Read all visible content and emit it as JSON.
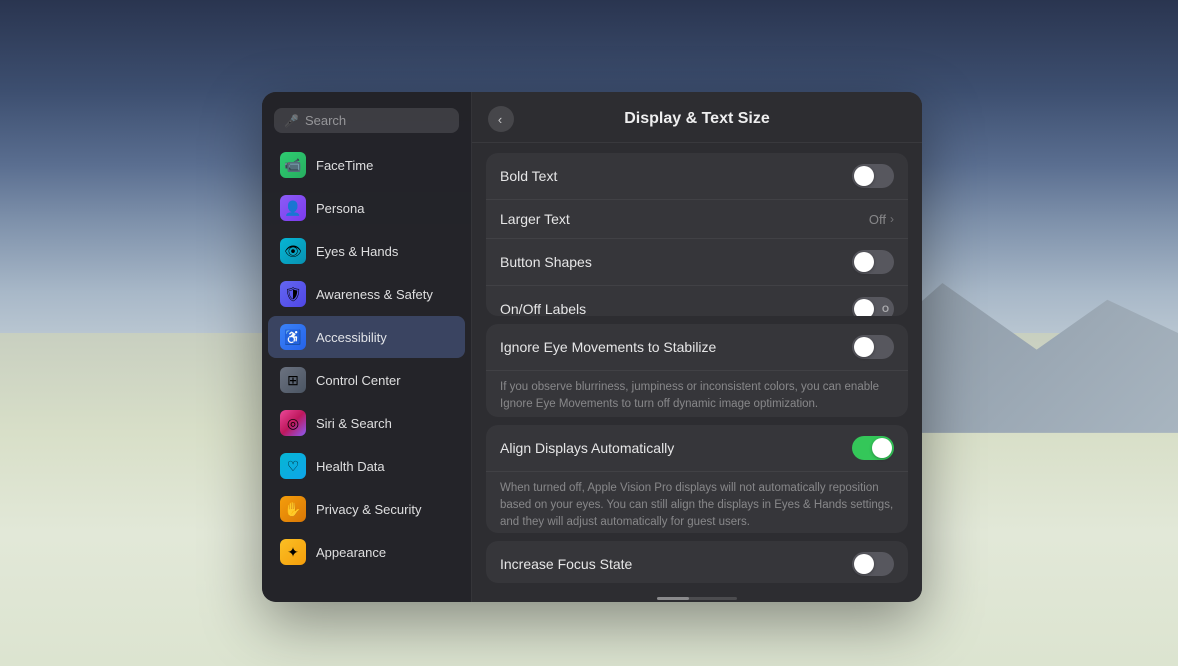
{
  "background": {
    "description": "Desert landscape with cloudy sky"
  },
  "sidebar": {
    "search": {
      "placeholder": "Search",
      "icon": "microphone"
    },
    "items": [
      {
        "id": "facetime",
        "label": "FaceTime",
        "icon": "📹",
        "iconClass": "icon-facetime",
        "active": false
      },
      {
        "id": "persona",
        "label": "Persona",
        "icon": "👤",
        "iconClass": "icon-persona",
        "active": false
      },
      {
        "id": "eyes-hands",
        "label": "Eyes & Hands",
        "icon": "👁",
        "iconClass": "icon-eyes",
        "active": false
      },
      {
        "id": "awareness-safety",
        "label": "Awareness & Safety",
        "icon": "🛡",
        "iconClass": "icon-awareness",
        "active": false
      },
      {
        "id": "accessibility",
        "label": "Accessibility",
        "icon": "♿",
        "iconClass": "icon-accessibility",
        "active": true
      },
      {
        "id": "control-center",
        "label": "Control Center",
        "icon": "⊞",
        "iconClass": "icon-control",
        "active": false
      },
      {
        "id": "siri-search",
        "label": "Siri & Search",
        "icon": "◎",
        "iconClass": "icon-siri",
        "active": false
      },
      {
        "id": "health-data",
        "label": "Health Data",
        "icon": "♡",
        "iconClass": "icon-health",
        "active": false
      },
      {
        "id": "privacy-security",
        "label": "Privacy & Security",
        "icon": "✋",
        "iconClass": "icon-privacy",
        "active": false
      },
      {
        "id": "appearance",
        "label": "Appearance",
        "icon": "✦",
        "iconClass": "icon-appearance",
        "active": false
      }
    ]
  },
  "main": {
    "title": "Display & Text Size",
    "back_button_label": "‹",
    "groups": [
      {
        "id": "text-group",
        "rows": [
          {
            "id": "bold-text",
            "label": "Bold Text",
            "control": "toggle",
            "value": false
          },
          {
            "id": "larger-text",
            "label": "Larger Text",
            "control": "disclosure",
            "value": "Off"
          },
          {
            "id": "button-shapes",
            "label": "Button Shapes",
            "control": "toggle",
            "value": false
          },
          {
            "id": "on-off-labels",
            "label": "On/Off Labels",
            "control": "toggle-o",
            "value": false
          }
        ]
      },
      {
        "id": "eye-movement-group",
        "rows": [
          {
            "id": "ignore-eye-movements",
            "label": "Ignore Eye Movements to Stabilize",
            "control": "toggle",
            "value": false
          }
        ],
        "description": "If you observe blurriness, jumpiness or inconsistent colors, you can enable Ignore Eye Movements to turn off dynamic image optimization."
      },
      {
        "id": "align-group",
        "rows": [
          {
            "id": "align-displays",
            "label": "Align Displays Automatically",
            "control": "toggle",
            "value": true
          }
        ],
        "description": "When turned off, Apple Vision Pro displays will not automatically reposition based on your eyes. You can still align the displays in Eyes & Hands settings, and they will adjust automatically for guest users."
      },
      {
        "id": "focus-group",
        "rows": [
          {
            "id": "increase-focus-state",
            "label": "Increase Focus State",
            "control": "toggle",
            "value": false
          }
        ]
      }
    ]
  }
}
